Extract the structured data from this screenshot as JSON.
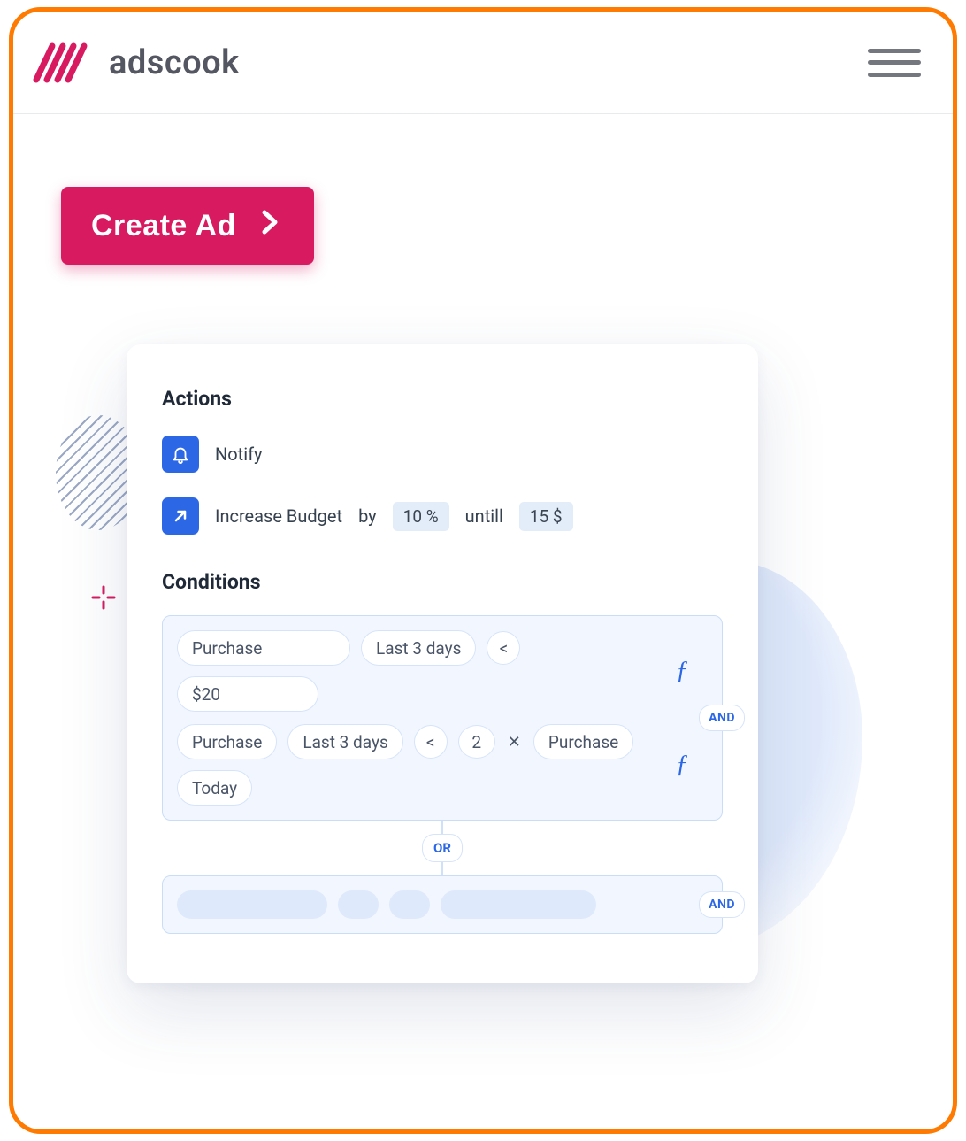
{
  "brand": {
    "name": "adscook"
  },
  "cta": {
    "label": "Create Ad"
  },
  "card": {
    "sections": {
      "actions": "Actions",
      "conditions": "Conditions"
    },
    "actions": {
      "notify": {
        "label": "Notify"
      },
      "increase_budget": {
        "label": "Increase Budget",
        "by_word": "by",
        "by_value": "10 %",
        "until_word": "untill",
        "until_value": "15 $"
      }
    },
    "logic": {
      "and": "AND",
      "or": "OR"
    },
    "conditions": {
      "group1": {
        "line1": {
          "metric": "Purchase",
          "range": "Last 3 days",
          "op": "<",
          "value": "$20"
        },
        "line2": {
          "metric": "Purchase",
          "range": "Last 3 days",
          "op": "<",
          "mult": "2",
          "times": "✕",
          "metric2": "Purchase",
          "range2": "Today"
        }
      }
    }
  }
}
